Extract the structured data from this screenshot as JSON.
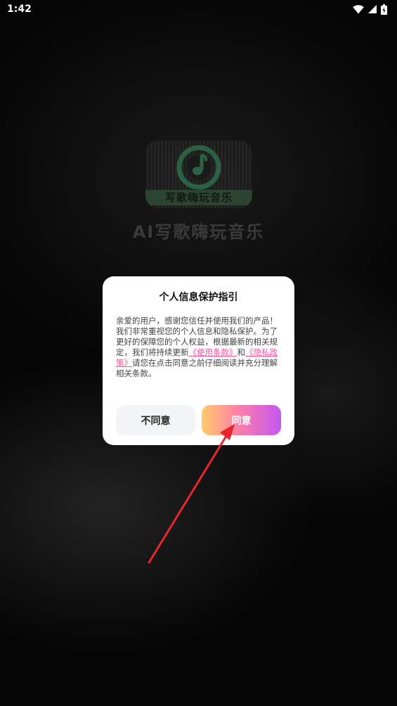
{
  "status_bar": {
    "time": "1:42"
  },
  "splash": {
    "logo_text": "写歌嗨玩音乐",
    "app_title": "AI写歌嗨玩音乐"
  },
  "dialog": {
    "title": "个人信息保护指引",
    "body_intro": "亲爱的用户，感谢您信任并使用我们的产品！我们非常重视您的个人信息和隐私保护。为了更好的保障您的个人权益，根据最新的相关规定，我们将持续更新",
    "terms_link": "《使用条款》",
    "conjunction": "和",
    "privacy_link": "《隐私政策》",
    "body_outro": "请您在点击同意之前仔细阅读并充分理解相关条款。",
    "disagree_label": "不同意",
    "agree_label": "同意"
  },
  "colors": {
    "link": "#ff4f9a",
    "agree_gradient_start": "#ffcb6b",
    "agree_gradient_mid": "#ff7fa6",
    "agree_gradient_end": "#c257f0",
    "annotation_arrow": "#e8252a"
  }
}
